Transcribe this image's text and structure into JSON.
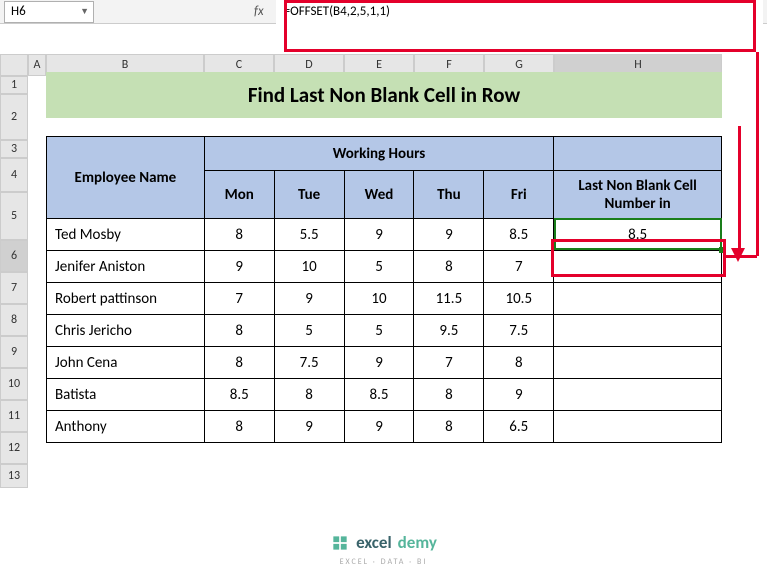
{
  "nameBox": {
    "value": "H6"
  },
  "formulaBar": {
    "fxLabel": "fx",
    "value": "=OFFSET(B4,2,5,1,1)"
  },
  "columns": [
    "A",
    "B",
    "C",
    "D",
    "E",
    "F",
    "G",
    "H"
  ],
  "rows": [
    "1",
    "2",
    "3",
    "4",
    "5",
    "6",
    "7",
    "8",
    "9",
    "10",
    "11",
    "12",
    "13"
  ],
  "title": "Find Last Non Blank Cell in Row",
  "headers": {
    "employee": "Employee Name",
    "workingHours": "Working Hours",
    "days": [
      "Mon",
      "Tue",
      "Wed",
      "Thu",
      "Fri"
    ],
    "lastNonBlank": "Last Non Blank Cell Number in"
  },
  "employees": [
    {
      "name": "Ted Mosby",
      "hours": [
        "8",
        "5.5",
        "9",
        "9",
        "8.5"
      ],
      "last": "8.5"
    },
    {
      "name": "Jenifer Aniston",
      "hours": [
        "9",
        "10",
        "5",
        "8",
        "7"
      ],
      "last": ""
    },
    {
      "name": "Robert pattinson",
      "hours": [
        "7",
        "9",
        "10",
        "11.5",
        "10.5"
      ],
      "last": ""
    },
    {
      "name": "Chris Jericho",
      "hours": [
        "8",
        "5",
        "5",
        "9.5",
        "7.5"
      ],
      "last": ""
    },
    {
      "name": "John Cena",
      "hours": [
        "8",
        "7.5",
        "9",
        "7",
        "8"
      ],
      "last": ""
    },
    {
      "name": "Batista",
      "hours": [
        "8.5",
        "8",
        "8.5",
        "8",
        "9"
      ],
      "last": ""
    },
    {
      "name": "Anthony",
      "hours": [
        "8",
        "9",
        "9",
        "8",
        "6.5"
      ],
      "last": ""
    }
  ],
  "footer": {
    "brand1": "excel",
    "brand2": "demy",
    "tagline": "EXCEL · DATA · BI"
  },
  "chart_data": {
    "type": "table",
    "title": "Find Last Non Blank Cell in Row",
    "columns": [
      "Employee Name",
      "Mon",
      "Tue",
      "Wed",
      "Thu",
      "Fri",
      "Last Non Blank Cell Number in"
    ],
    "rows": [
      [
        "Ted Mosby",
        8,
        5.5,
        9,
        9,
        8.5,
        8.5
      ],
      [
        "Jenifer Aniston",
        9,
        10,
        5,
        8,
        7,
        null
      ],
      [
        "Robert pattinson",
        7,
        9,
        10,
        11.5,
        10.5,
        null
      ],
      [
        "Chris Jericho",
        8,
        5,
        5,
        9.5,
        7.5,
        null
      ],
      [
        "John Cena",
        8,
        7.5,
        9,
        7,
        8,
        null
      ],
      [
        "Batista",
        8.5,
        8,
        8.5,
        8,
        9,
        null
      ],
      [
        "Anthony",
        8,
        9,
        9,
        8,
        6.5,
        null
      ]
    ]
  }
}
